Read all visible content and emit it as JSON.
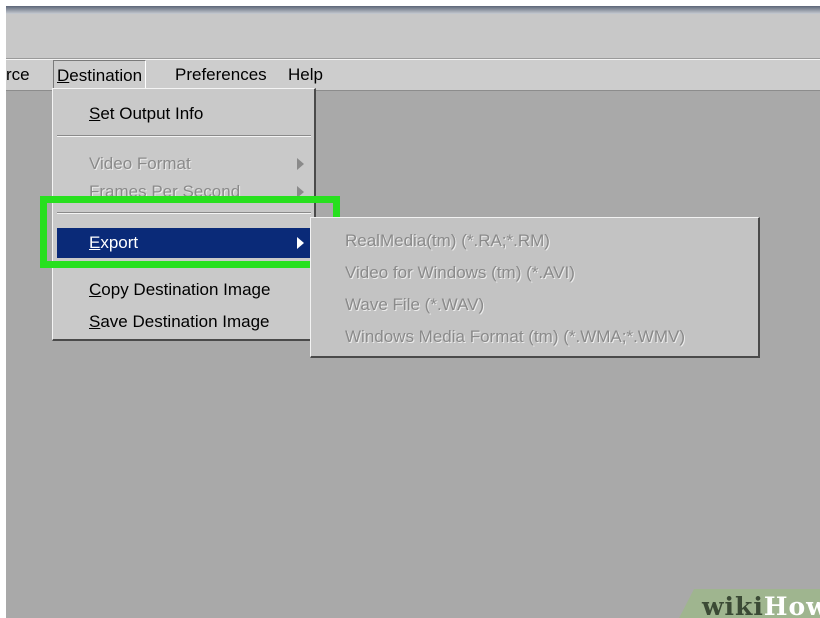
{
  "menubar": {
    "items": [
      {
        "label": "rce",
        "underline": ""
      },
      {
        "underline": "D",
        "label": "estination"
      },
      {
        "label": "Preferences",
        "underline": ""
      },
      {
        "label": "Help",
        "underline": ""
      }
    ]
  },
  "destination_menu": {
    "items": [
      {
        "underline": "S",
        "label": "et Output Info",
        "enabled": true
      },
      {
        "label": "Video Format",
        "enabled": false,
        "submenu": true
      },
      {
        "label": "Frames Per Second",
        "enabled": false,
        "submenu": true
      },
      {
        "underline": "E",
        "label": "xport",
        "enabled": true,
        "submenu": true,
        "highlighted": true
      },
      {
        "underline": "C",
        "label": "opy Destination Image",
        "enabled": true
      },
      {
        "underline": "S",
        "label": "ave Destination Image",
        "enabled": true
      }
    ]
  },
  "export_submenu": {
    "items": [
      {
        "label": "RealMedia(tm) (*.RA;*.RM)",
        "enabled": false
      },
      {
        "label": "Video for Windows (tm) (*.AVI)",
        "enabled": false
      },
      {
        "label": "Wave File (*.WAV)",
        "enabled": false
      },
      {
        "label": "Windows Media Format (tm) (*.WMA;*.WMV)",
        "enabled": false
      }
    ]
  },
  "watermark": {
    "part1": "wiki",
    "part2": "How"
  },
  "colors": {
    "highlight_box": "#27e01e",
    "menu_selection": "#0a2a78",
    "workspace": "#a9a9a9",
    "menu_background": "#c9c9c9"
  }
}
